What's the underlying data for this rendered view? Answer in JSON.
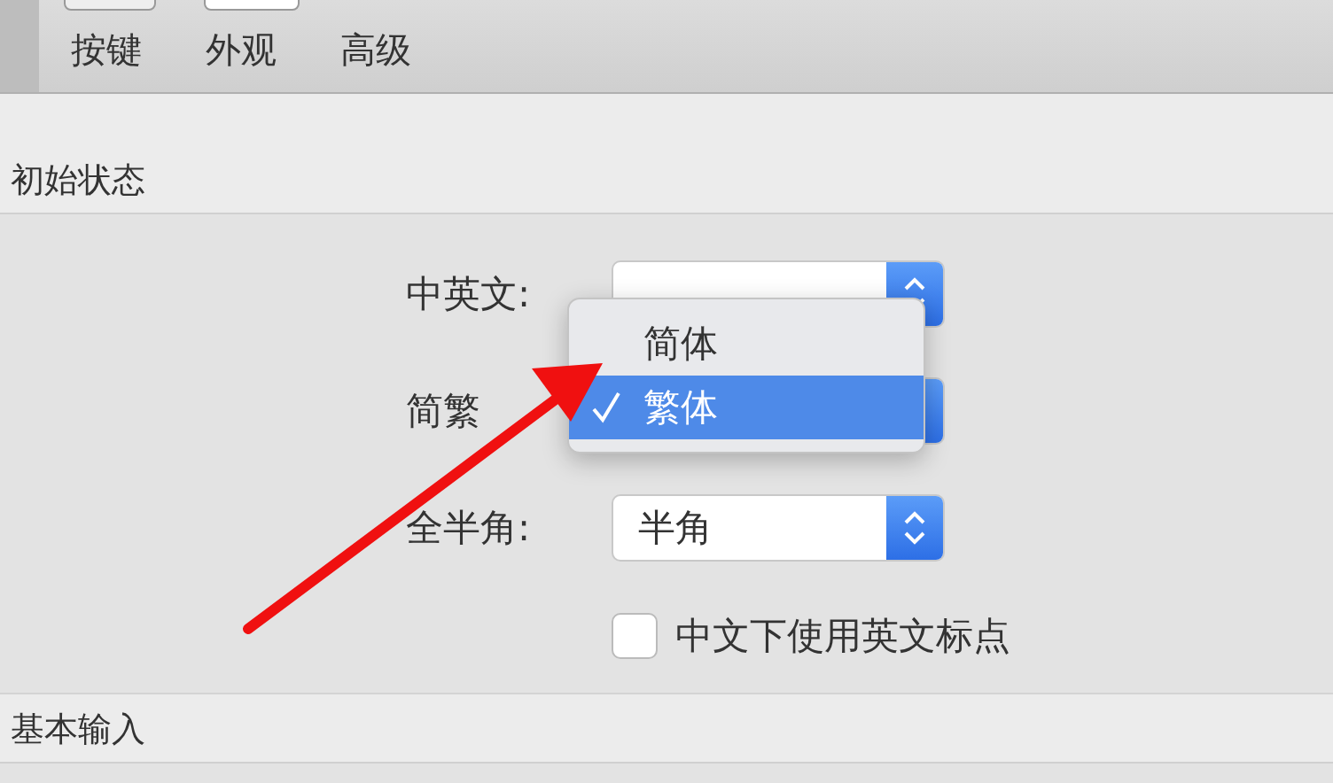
{
  "tabs": [
    {
      "label": "按键",
      "selected": false
    },
    {
      "label": "外观",
      "selected": false
    },
    {
      "label": "高级",
      "selected": false
    }
  ],
  "sections": [
    {
      "title": "初始状态",
      "rows": [
        {
          "kind": "popup",
          "label": "中英文:"
        },
        {
          "kind": "popup",
          "label": "简繁"
        },
        {
          "kind": "popup",
          "label": "全半角:",
          "value": "半角"
        },
        {
          "kind": "checkbox",
          "label": "中文下使用英文标点",
          "checked": false
        }
      ]
    },
    {
      "title": "基本输入"
    }
  ],
  "menu": {
    "items": [
      {
        "label": "简体",
        "selected": false
      },
      {
        "label": "繁体",
        "selected": true
      }
    ]
  }
}
